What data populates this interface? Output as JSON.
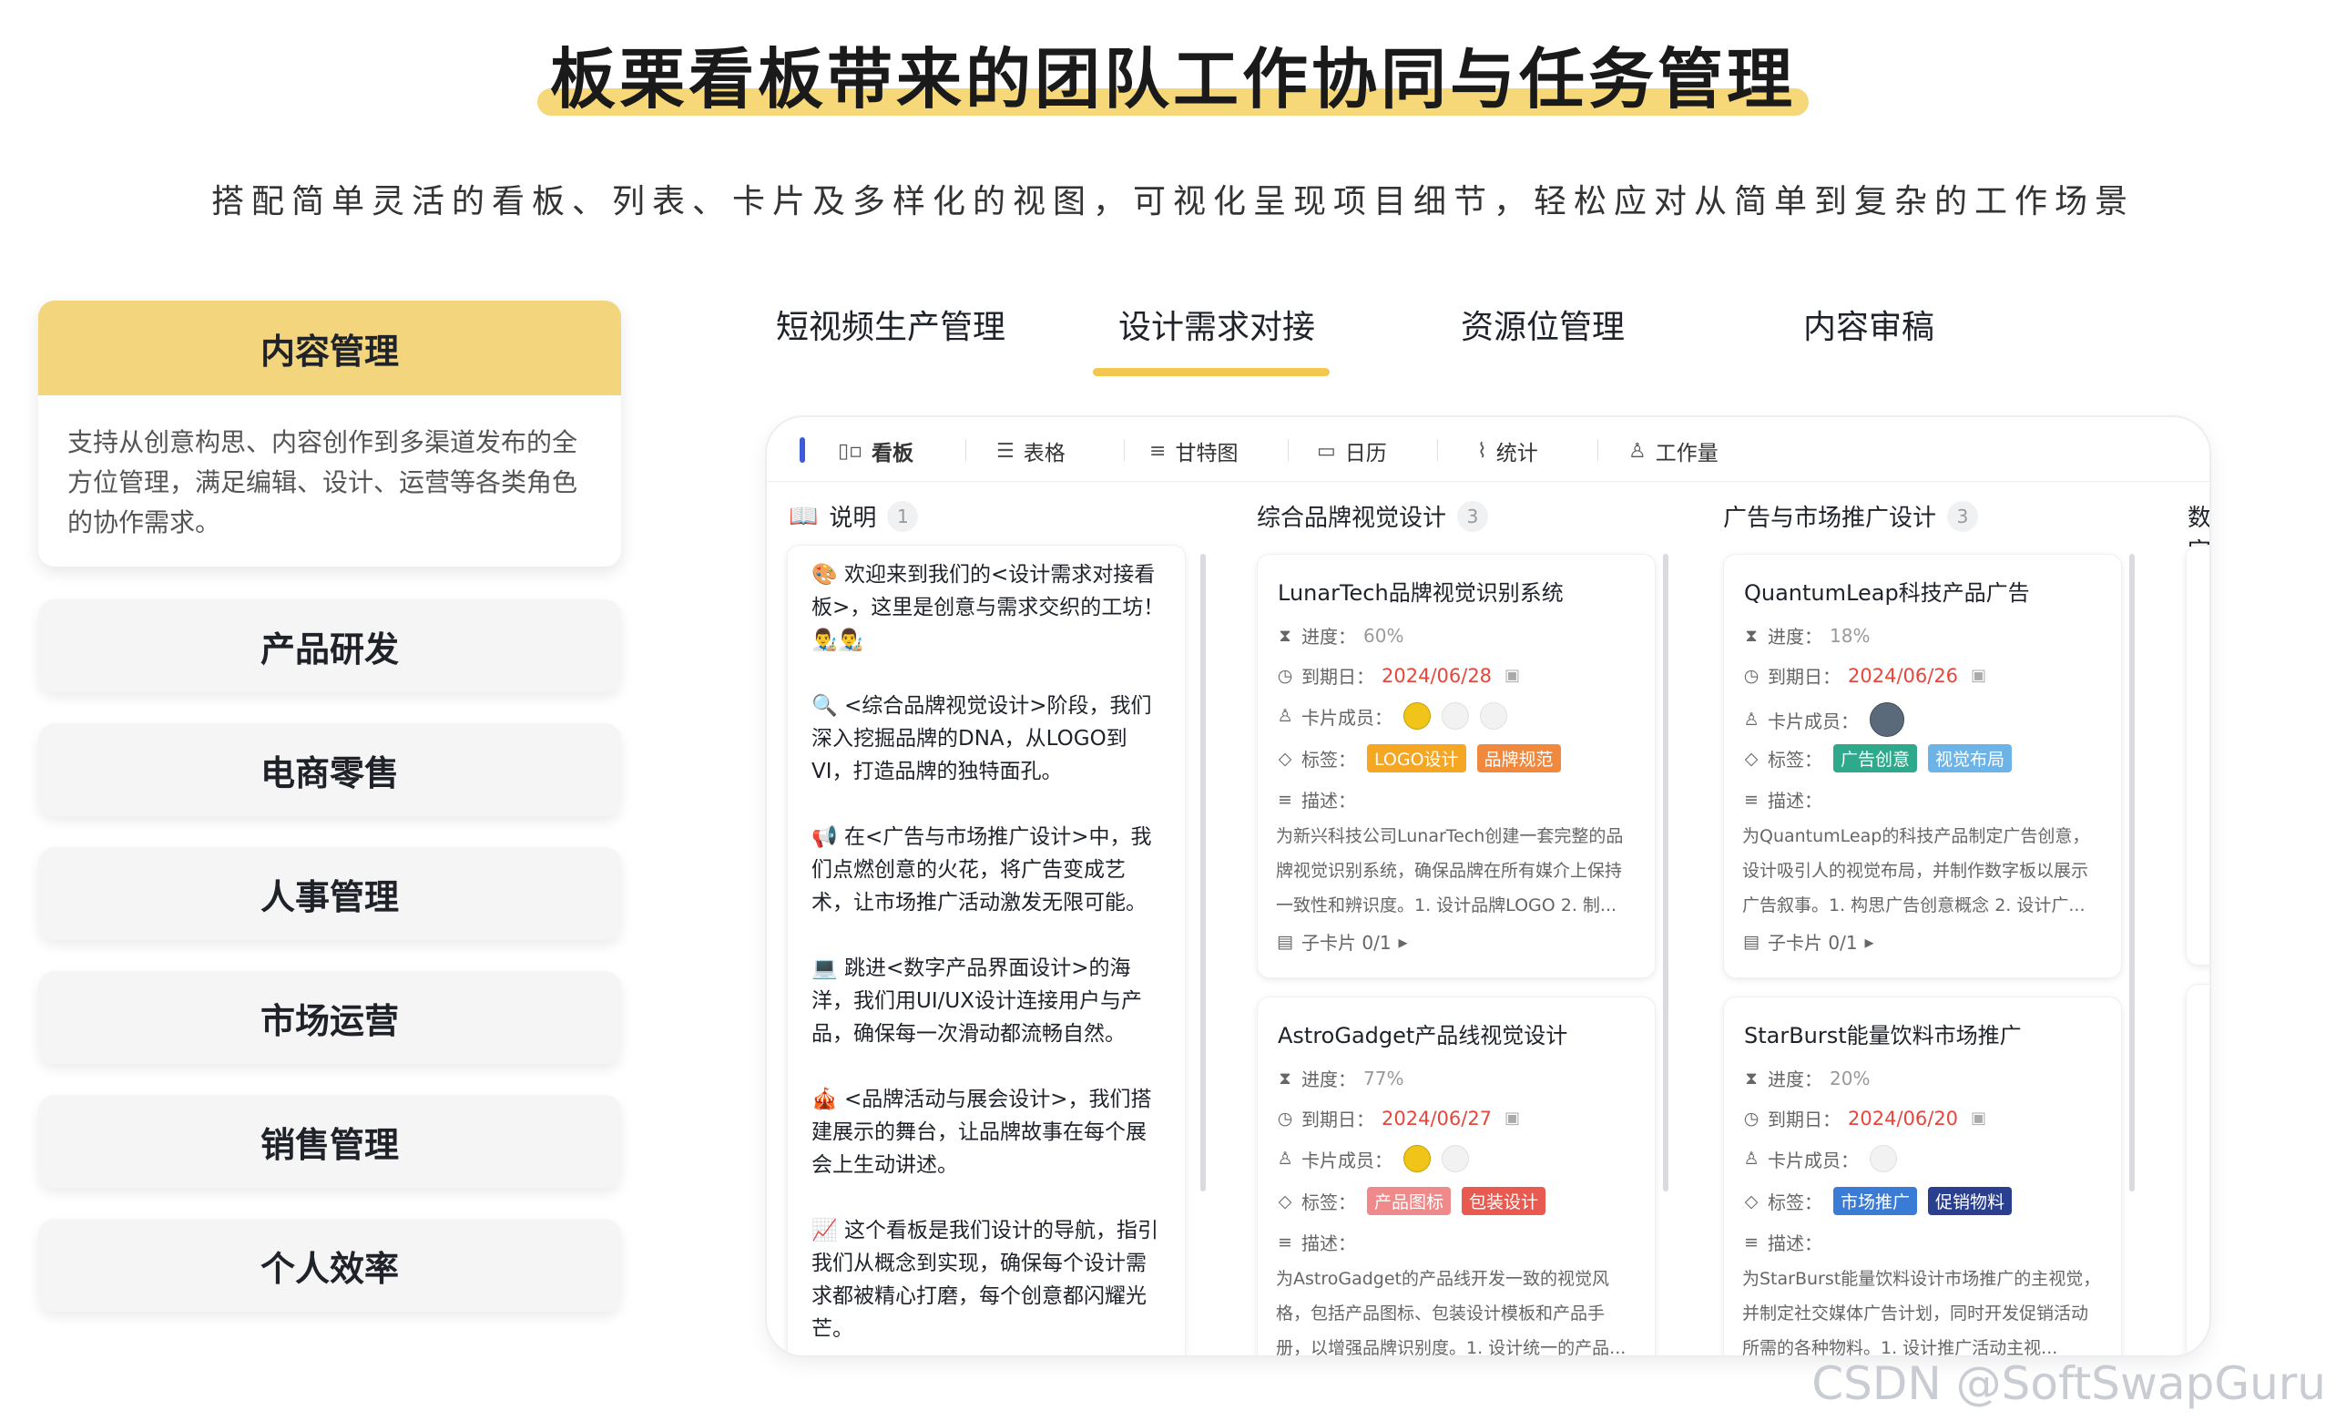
{
  "header": {
    "title": "板栗看板带来的团队工作协同与任务管理",
    "subtitle": "搭配简单灵活的看板、列表、卡片及多样化的视图，可视化呈现项目细节，轻松应对从简单到复杂的工作场景"
  },
  "categories": {
    "active": {
      "label": "内容管理",
      "description": "支持从创意构思、内容创作到多渠道发布的全方位管理，满足编辑、设计、运营等各类角色的协作需求。"
    },
    "items": [
      "产品研发",
      "电商零售",
      "人事管理",
      "市场运营",
      "销售管理",
      "个人效率"
    ]
  },
  "tabs": [
    "短视频生产管理",
    "设计需求对接",
    "资源位管理",
    "内容审稿"
  ],
  "active_tab": "设计需求对接",
  "views": [
    "看板",
    "表格",
    "甘特图",
    "日历",
    "统计",
    "工作量"
  ],
  "columns": {
    "explain": {
      "title": "说明",
      "count": "1",
      "paragraphs": [
        "🎨 欢迎来到我们的<设计需求对接看板>，这里是创意与需求交织的工坊！👨‍🎨👨‍🎨",
        "🔍 <综合品牌视觉设计>阶段，我们深入挖掘品牌的DNA，从LOGO到VI，打造品牌的独特面孔。",
        "📢 在<广告与市场推广设计>中，我们点燃创意的火花，将广告变成艺术，让市场推广活动激发无限可能。",
        "💻 跳进<数字产品界面设计>的海洋，我们用UI/UX设计连接用户与产品，确保每一次滑动都流畅自然。",
        "🎪 <品牌活动与展会设计>，我们搭建展示的舞台，让品牌故事在每个展会上生动讲述。",
        "📈 这个看板是我们设计的导航，指引我们从概念到实现，确保每个设计需求都被精心打磨，每个创意都闪耀光芒。"
      ]
    },
    "brand": {
      "title": "综合品牌视觉设计",
      "count": "3"
    },
    "ad": {
      "title": "广告与市场推广设计",
      "count": "3"
    },
    "partial": {
      "title": "数字"
    }
  },
  "labels": {
    "progress": "进度：",
    "due": "到期日：",
    "members": "卡片成员：",
    "tags": "标签：",
    "desc": "描述：",
    "subcard": "子卡片 0/1"
  },
  "cards": [
    {
      "title": "LunarTech品牌视觉识别系统",
      "progress": "60%",
      "due": "2024/06/28",
      "tags": [
        {
          "text": "LOGO设计",
          "color": "#f5a623"
        },
        {
          "text": "品牌规范",
          "color": "#f0883e"
        }
      ],
      "desc": "为新兴科技公司LunarTech创建一套完整的品牌视觉识别系统，确保品牌在所有媒介上保持一致性和辨识度。1. 设计品牌LOGO 2. 制..."
    },
    {
      "title": "AstroGadget产品线视觉设计",
      "progress": "77%",
      "due": "2024/06/27",
      "tags": [
        {
          "text": "产品图标",
          "color": "#f08a8a"
        },
        {
          "text": "包装设计",
          "color": "#e85a4f"
        }
      ],
      "desc": "为AstroGadget的产品线开发一致的视觉风格，包括产品图标、包装设计模板和产品手册，以增强品牌识别度。1. 设计统一的产品..."
    },
    {
      "title": "QuantumLeap科技产品广告",
      "progress": "18%",
      "due": "2024/06/26",
      "tags": [
        {
          "text": "广告创意",
          "color": "#2fa98c"
        },
        {
          "text": "视觉布局",
          "color": "#6cb4e8"
        }
      ],
      "desc": "为QuantumLeap的科技产品制定广告创意，设计吸引人的视觉布局，并制作数字板以展示广告叙事。1. 构思广告创意概念 2. 设计广..."
    },
    {
      "title": "StarBurst能量饮料市场推广",
      "progress": "20%",
      "due": "2024/06/20",
      "tags": [
        {
          "text": "市场推广",
          "color": "#3a7bd5"
        },
        {
          "text": "促销物料",
          "color": "#2a3f8f"
        }
      ],
      "desc": "为StarBurst能量饮料设计市场推广的主视觉，并制定社交媒体广告计划，同时开发促销活动所需的各种物料。1. 设计推广活动主视..."
    }
  ],
  "watermark": "CSDN @SoftSwapGuru"
}
